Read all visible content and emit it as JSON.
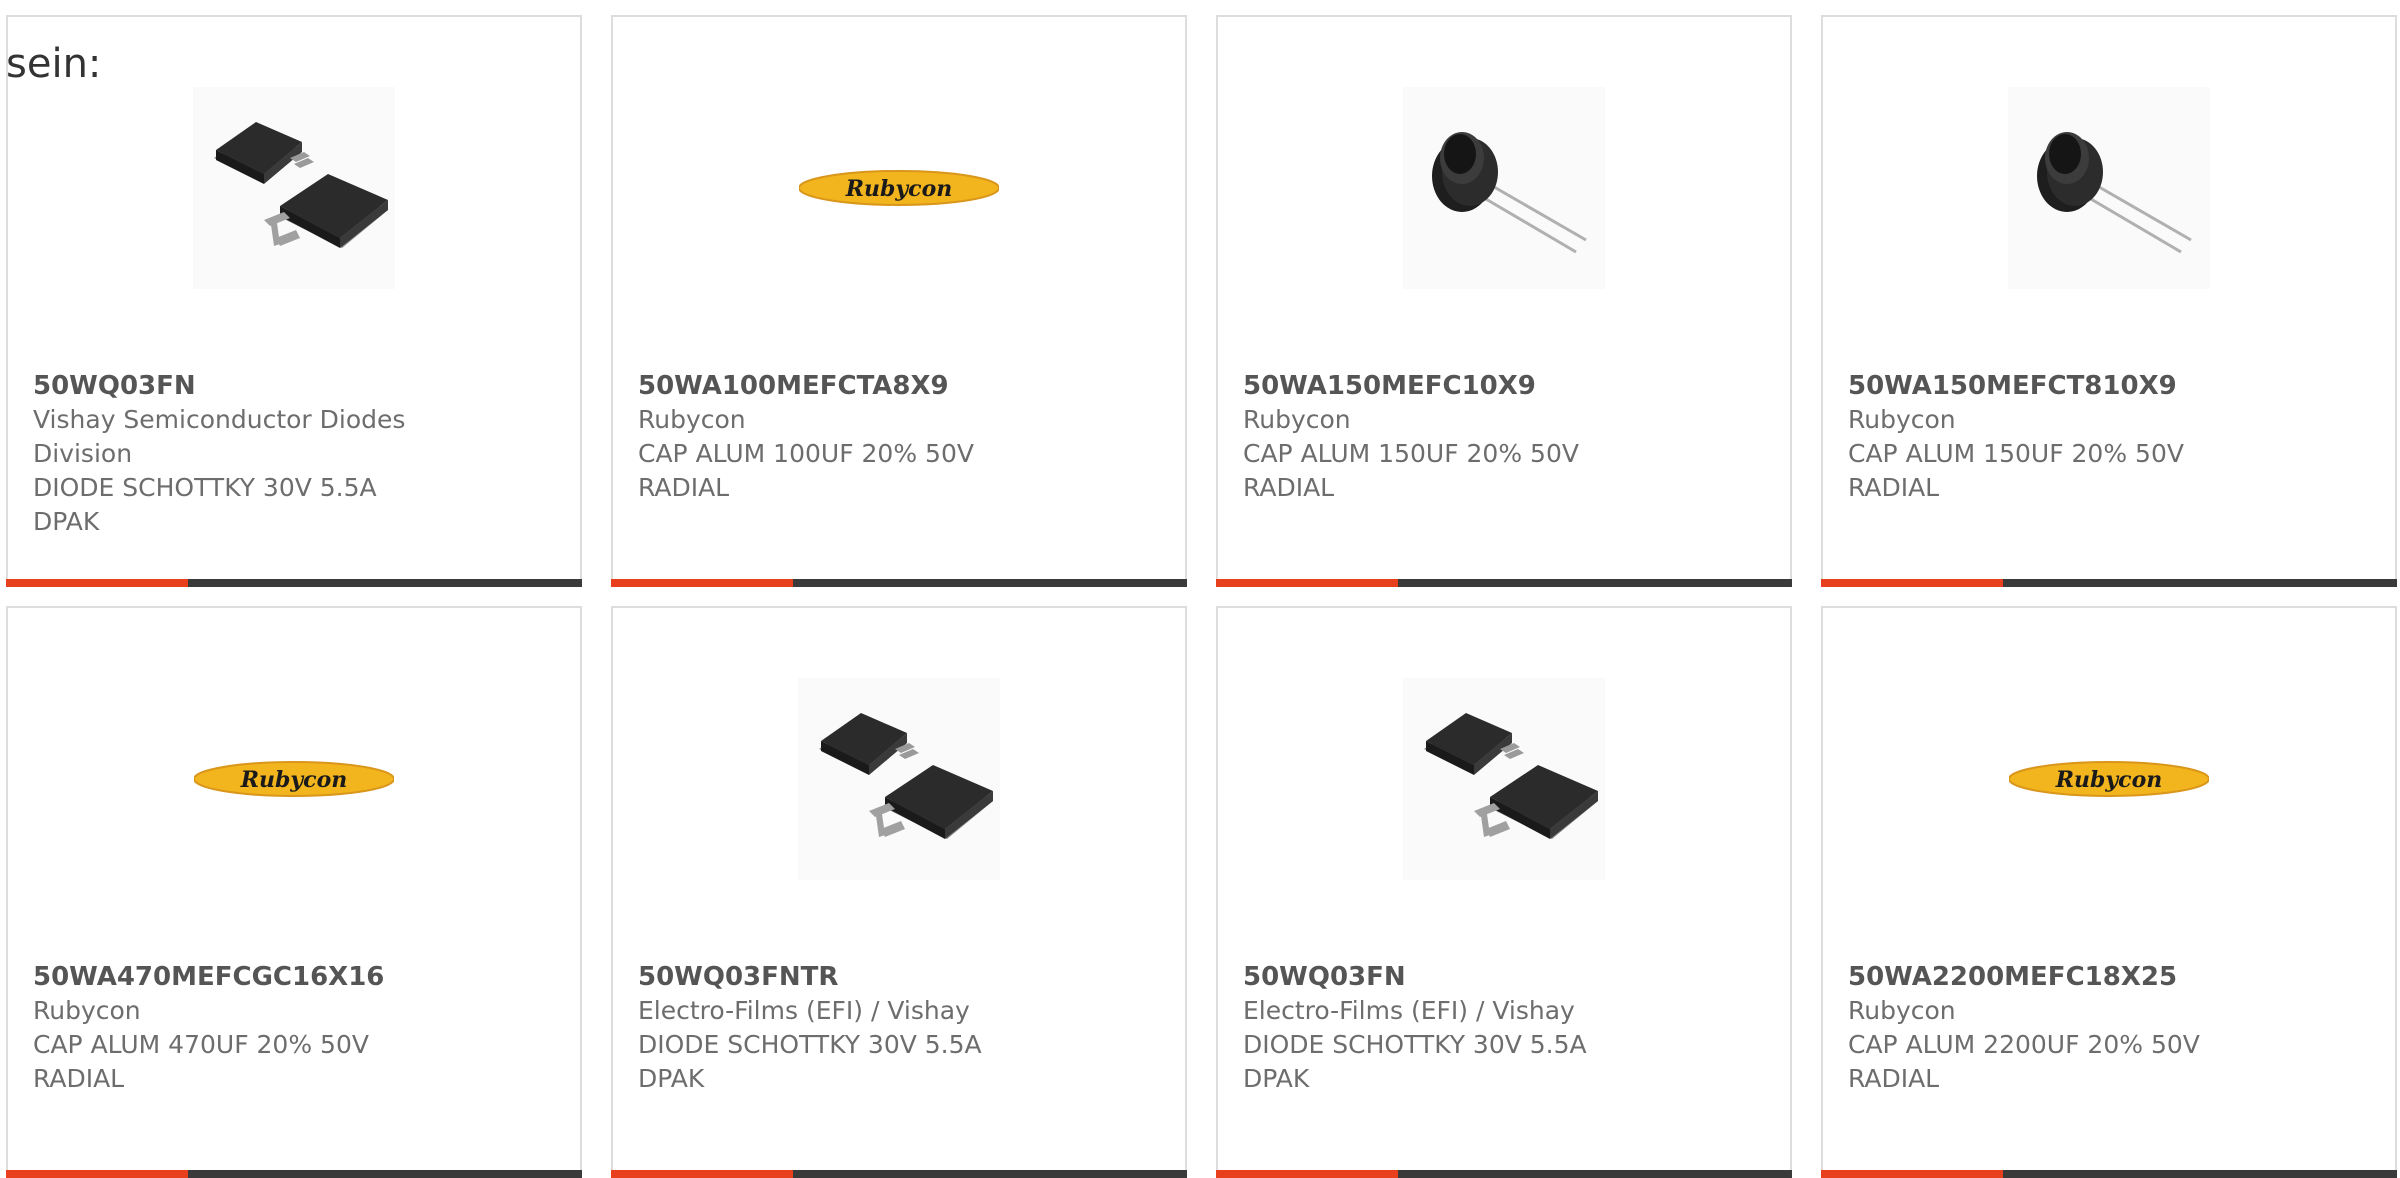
{
  "intro_text": "sein:",
  "colors": {
    "accent": "#e8401c",
    "bar": "#3a3a3a",
    "border": "#dddddd"
  },
  "products": [
    {
      "part": "50WQ03FN",
      "manufacturer": "Vishay Semiconductor Diodes Division",
      "mfr_lines": [
        "Vishay Semiconductor Diodes",
        "Division"
      ],
      "description_lines": [
        "DIODE SCHOTTKY 30V 5.5A",
        "DPAK"
      ],
      "image": "dpak-diode-icon"
    },
    {
      "part": "50WA100MEFCTA8X9",
      "manufacturer": "Rubycon",
      "mfr_lines": [
        "Rubycon"
      ],
      "description_lines": [
        "CAP ALUM 100UF 20% 50V",
        "RADIAL"
      ],
      "image": "rubycon-logo"
    },
    {
      "part": "50WA150MEFC10X9",
      "manufacturer": "Rubycon",
      "mfr_lines": [
        "Rubycon"
      ],
      "description_lines": [
        "CAP ALUM 150UF 20% 50V",
        "RADIAL"
      ],
      "image": "radial-capacitor-icon"
    },
    {
      "part": "50WA150MEFCT810X9",
      "manufacturer": "Rubycon",
      "mfr_lines": [
        "Rubycon"
      ],
      "description_lines": [
        "CAP ALUM 150UF 20% 50V",
        "RADIAL"
      ],
      "image": "radial-capacitor-icon"
    },
    {
      "part": "50WA470MEFCGC16X16",
      "manufacturer": "Rubycon",
      "mfr_lines": [
        "Rubycon"
      ],
      "description_lines": [
        "CAP ALUM 470UF 20% 50V",
        "RADIAL"
      ],
      "image": "rubycon-logo"
    },
    {
      "part": "50WQ03FNTR",
      "manufacturer": "Electro-Films (EFI) / Vishay",
      "mfr_lines": [
        "Electro-Films (EFI) / Vishay"
      ],
      "description_lines": [
        "DIODE SCHOTTKY 30V 5.5A",
        "DPAK"
      ],
      "image": "dpak-diode-icon"
    },
    {
      "part": "50WQ03FN",
      "manufacturer": "Electro-Films (EFI) / Vishay",
      "mfr_lines": [
        "Electro-Films (EFI) / Vishay"
      ],
      "description_lines": [
        "DIODE SCHOTTKY 30V 5.5A",
        "DPAK"
      ],
      "image": "dpak-diode-icon"
    },
    {
      "part": "50WA2200MEFC18X25",
      "manufacturer": "Rubycon",
      "mfr_lines": [
        "Rubycon"
      ],
      "description_lines": [
        "CAP ALUM 2200UF 20% 50V",
        "RADIAL"
      ],
      "image": "rubycon-logo"
    }
  ],
  "logo_text": "Rubycon"
}
